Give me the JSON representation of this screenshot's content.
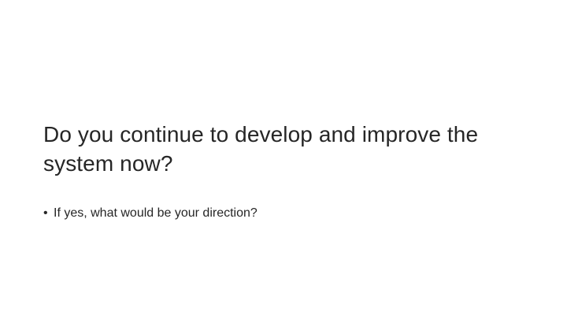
{
  "slide": {
    "title": "Do you continue to develop and improve the system now?",
    "bullets": [
      {
        "marker": "•",
        "text": "If yes, what would be your direction?"
      }
    ]
  }
}
